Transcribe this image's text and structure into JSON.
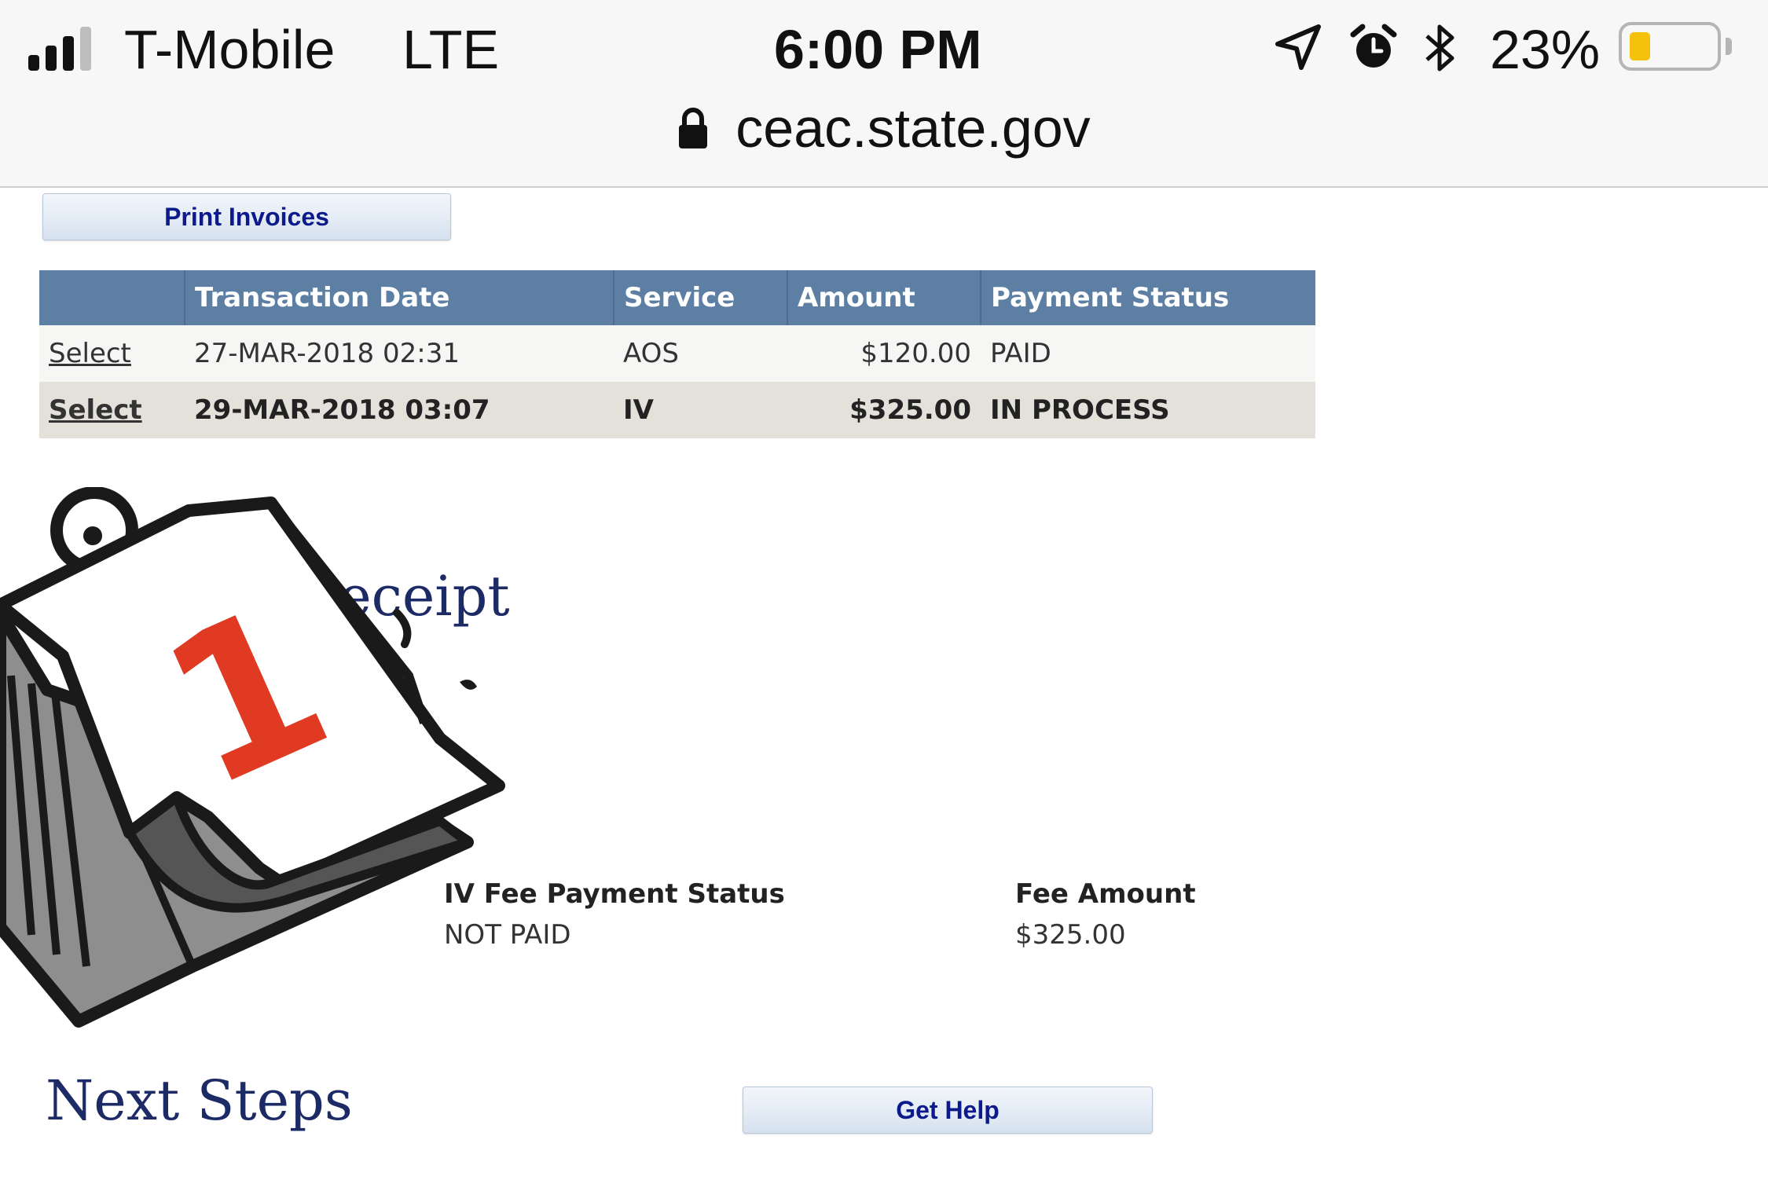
{
  "status_bar": {
    "carrier": "T-Mobile",
    "network": "LTE",
    "time": "6:00 PM",
    "battery": "23%",
    "battery_level": 0.23,
    "icons": [
      "signal-icon",
      "location-icon",
      "alarm-icon",
      "bluetooth-icon",
      "battery-icon"
    ]
  },
  "address_bar": {
    "url": "ceac.state.gov",
    "icon": "lock-icon"
  },
  "toolbar": {
    "print_label": "Print Invoices"
  },
  "transactions": {
    "columns": [
      "",
      "Transaction Date",
      "Service",
      "Amount",
      "Payment Status"
    ],
    "rows": [
      {
        "action": "Select",
        "date": "27-MAR-2018 02:31",
        "service": "AOS",
        "amount": "$120.00",
        "status": "PAID"
      },
      {
        "action": "Select",
        "date": "29-MAR-2018 03:07",
        "service": "IV",
        "amount": "$325.00",
        "status": "IN PROCESS"
      }
    ]
  },
  "receipt": {
    "title_visible": "ent Receipt",
    "status_label": "IV Fee Payment Status",
    "status_value": "NOT PAID",
    "amount_label": "Fee Amount",
    "amount_value": "$325.00"
  },
  "next_steps": {
    "title": "Next Steps",
    "help_label": "Get Help"
  },
  "overlay": {
    "icon": "calendar-icon",
    "number": "1"
  },
  "colors": {
    "table_header": "#5d7fa4",
    "heading": "#1c2a66",
    "button_text": "#0c1a8c",
    "calendar_number": "#e03a22",
    "battery": "#f4c20d"
  }
}
